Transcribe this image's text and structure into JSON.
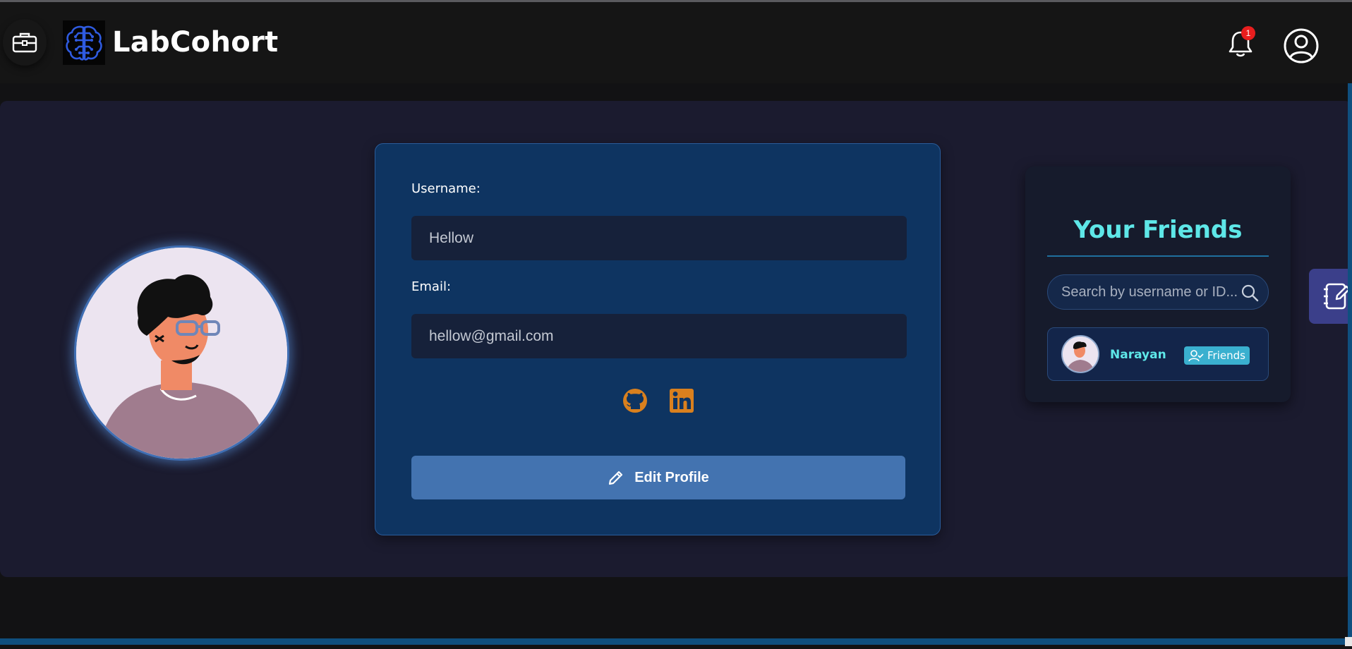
{
  "app": {
    "title": "LabCohort"
  },
  "header": {
    "notifications_count": "1"
  },
  "profile": {
    "username_label": "Username:",
    "username_value": "Hellow",
    "email_label": "Email:",
    "email_value": "hellow@gmail.com",
    "social_links": [
      "github-icon",
      "linkedin-icon"
    ],
    "edit_button_label": "Edit Profile"
  },
  "friends": {
    "title": "Your Friends",
    "search_placeholder": "Search by username or ID...",
    "items": [
      {
        "name": "Narayan",
        "status": "Friends"
      }
    ]
  },
  "colors": {
    "accent_cyan": "#5ee7e8",
    "card_bg": "#0e3461",
    "button_bg": "#4373b0",
    "social_orange": "#d9801e",
    "badge_red": "#e81e1e"
  }
}
